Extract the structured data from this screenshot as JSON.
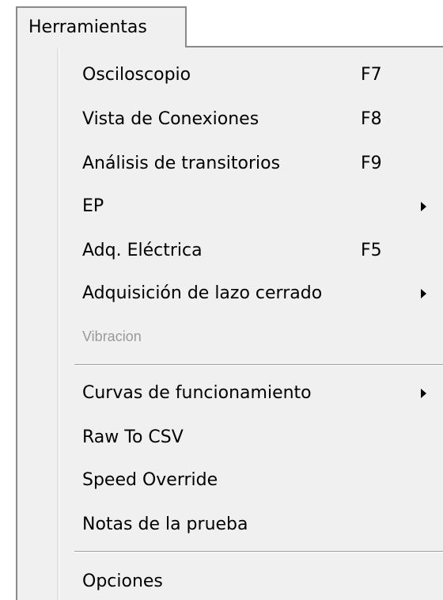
{
  "menu": {
    "title": "Herramientas",
    "items": [
      {
        "label": "Osciloscopio",
        "shortcut": "F7"
      },
      {
        "label": "Vista de Conexiones",
        "shortcut": "F8"
      },
      {
        "label": "Análisis de transitorios",
        "shortcut": "F9"
      },
      {
        "label": "EP",
        "submenu": true
      },
      {
        "label": "Adq. Eléctrica",
        "shortcut": "F5"
      },
      {
        "label": "Adquisición de lazo cerrado",
        "submenu": true
      },
      {
        "label": "Vibracion",
        "disabled": true
      },
      {
        "label": "Curvas de funcionamiento",
        "submenu": true
      },
      {
        "label": "Raw To CSV"
      },
      {
        "label": "Speed Override"
      },
      {
        "label": "Notas de la prueba"
      },
      {
        "label": "Opciones"
      }
    ]
  },
  "colors": {
    "menu_background": "#f0f0f0",
    "disabled_text": "#9a9a9a",
    "border": "#8a8a8a"
  }
}
